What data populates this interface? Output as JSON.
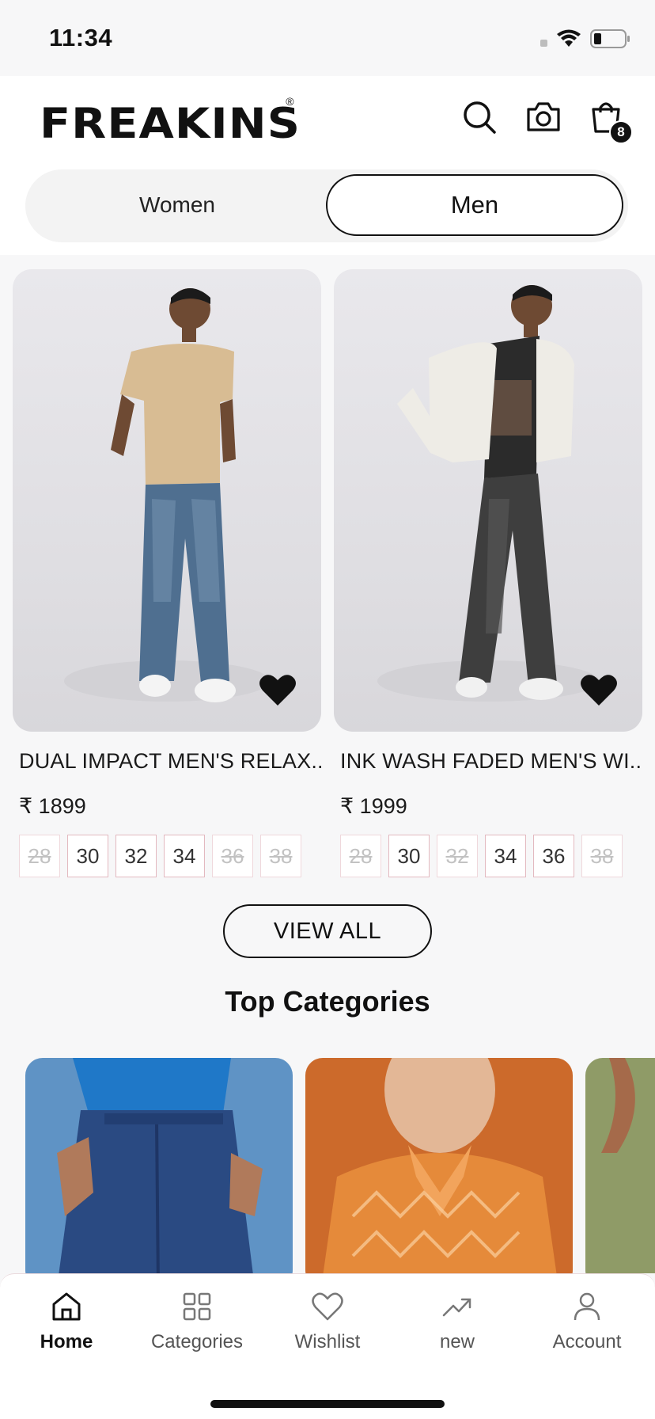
{
  "status_bar": {
    "time": "11:34"
  },
  "header": {
    "logo": "FREAKINS",
    "logo_mark": "®",
    "icons": [
      "search-icon",
      "camera-icon",
      "cart-icon"
    ],
    "cart_count": "8"
  },
  "gender_toggle": {
    "women": "Women",
    "men": "Men",
    "selected": "Men"
  },
  "products": [
    {
      "name": "DUAL IMPACT MEN'S RELAX...",
      "price": "₹ 1899",
      "wishlisted": true,
      "sizes": [
        {
          "label": "28",
          "available": false
        },
        {
          "label": "30",
          "available": true
        },
        {
          "label": "32",
          "available": true
        },
        {
          "label": "34",
          "available": true
        },
        {
          "label": "36",
          "available": false
        },
        {
          "label": "38",
          "available": false
        }
      ]
    },
    {
      "name": "INK WASH FADED MEN'S WI...",
      "price": "₹ 1999",
      "wishlisted": true,
      "sizes": [
        {
          "label": "28",
          "available": false
        },
        {
          "label": "30",
          "available": true
        },
        {
          "label": "32",
          "available": false
        },
        {
          "label": "34",
          "available": true
        },
        {
          "label": "36",
          "available": true
        },
        {
          "label": "38",
          "available": false
        }
      ]
    }
  ],
  "view_all": "VIEW ALL",
  "top_categories": {
    "title": "Top Categories"
  },
  "bottom_nav": [
    {
      "label": "Home",
      "icon": "home-icon",
      "active": true
    },
    {
      "label": "Categories",
      "icon": "grid-icon",
      "active": false
    },
    {
      "label": "Wishlist",
      "icon": "heart-icon",
      "active": false
    },
    {
      "label": "new",
      "icon": "trending-icon",
      "active": false
    },
    {
      "label": "Account",
      "icon": "user-icon",
      "active": false
    }
  ],
  "colors": {
    "accent": "#111111",
    "size_border": "#e3b9c0"
  }
}
